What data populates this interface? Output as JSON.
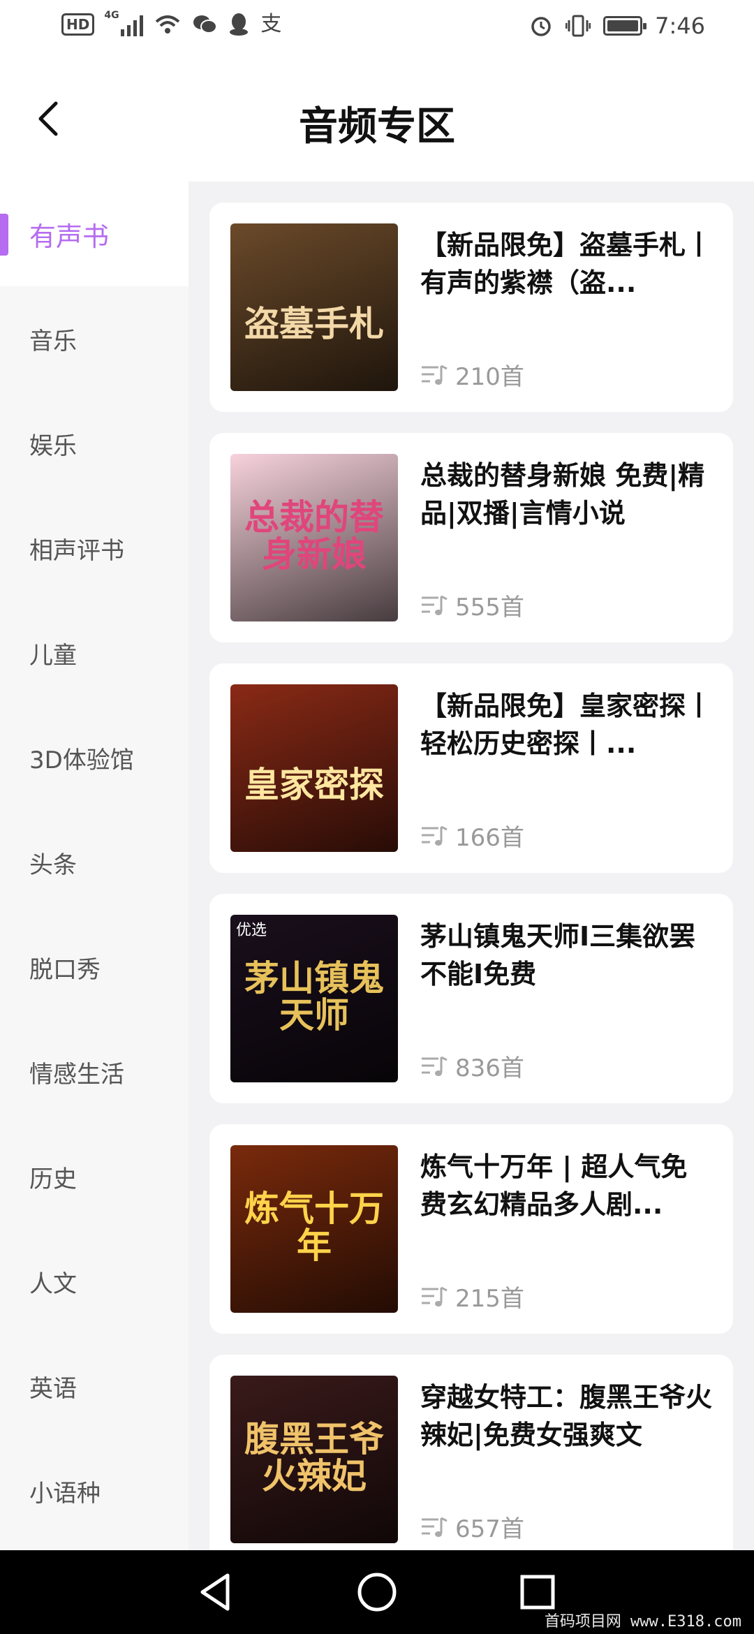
{
  "status_bar": {
    "hd": "HD",
    "network": "4G",
    "time": "7:46",
    "left_icons": [
      "hd-icon",
      "signal-icon",
      "wifi-icon",
      "wechat-icon",
      "qq-icon",
      "alipay-icon"
    ],
    "right_icons": [
      "alarm-icon",
      "vibrate-icon",
      "battery-icon"
    ]
  },
  "header": {
    "title": "音频专区",
    "back_icon": "chevron-left-icon"
  },
  "sidebar": {
    "active_color": "#b56cf0",
    "items": [
      {
        "label": "有声书",
        "active": true
      },
      {
        "label": "音乐"
      },
      {
        "label": "娱乐"
      },
      {
        "label": "相声评书"
      },
      {
        "label": "儿童"
      },
      {
        "label": "3D体验馆"
      },
      {
        "label": "头条"
      },
      {
        "label": "脱口秀"
      },
      {
        "label": "情感生活"
      },
      {
        "label": "历史"
      },
      {
        "label": "人文"
      },
      {
        "label": "英语"
      },
      {
        "label": "小语种"
      }
    ]
  },
  "albums": [
    {
      "title": "【新品限免】盗墓手札丨有声的紫襟（盗...",
      "count": "210首",
      "cover_text": "盗墓手札",
      "cover_bg": "#6b4a2a",
      "cover_fg": "#f3d8a8"
    },
    {
      "title": "总裁的替身新娘 免费|精品|双播|言情小说",
      "count": "555首",
      "cover_text": "总裁的替身新娘",
      "cover_bg": "#f7d2dc",
      "cover_fg": "#e0457b"
    },
    {
      "title": "【新品限免】皇家密探丨轻松历史密探丨...",
      "count": "166首",
      "cover_text": "皇家密探",
      "cover_bg": "#8a2a16",
      "cover_fg": "#ffe7a0"
    },
    {
      "title": "茅山镇鬼天师I三集欲罢不能I免费",
      "count": "836首",
      "cover_text": "茅山镇鬼天师",
      "cover_bg": "#1a0f1c",
      "cover_fg": "#e7c15a",
      "badge": "优选"
    },
    {
      "title": "炼气十万年 | 超人气免费玄幻精品多人剧...",
      "count": "215首",
      "cover_text": "炼气十万年",
      "cover_bg": "#7a2a0c",
      "cover_fg": "#ffd34a"
    },
    {
      "title": "穿越女特工：腹黑王爷火辣妃|免费女强爽文",
      "count": "657首",
      "cover_text": "腹黑王爷火辣妃",
      "cover_bg": "#3a1a1a",
      "cover_fg": "#f0c36a"
    }
  ],
  "nav_bar": {
    "icons": [
      "back-triangle-icon",
      "home-circle-icon",
      "recents-square-icon"
    ]
  },
  "watermark": "首码项目网 www.E318.com"
}
